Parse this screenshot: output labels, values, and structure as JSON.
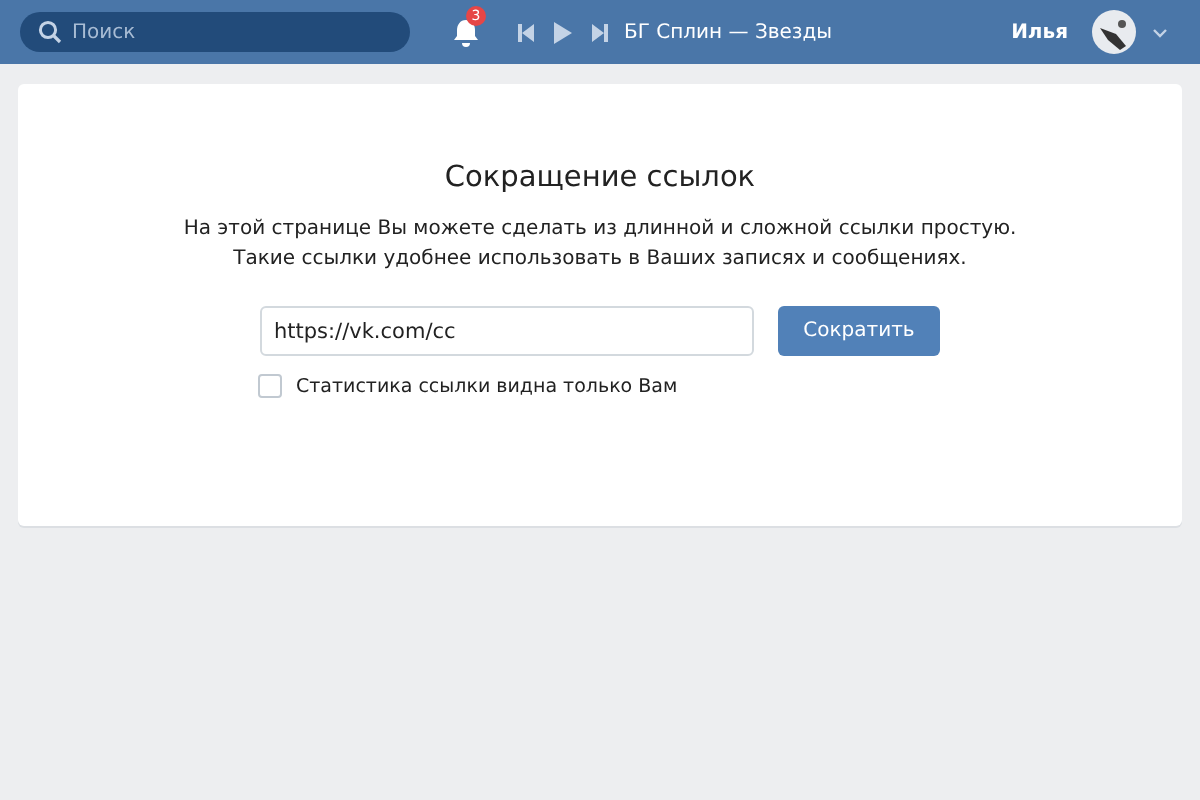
{
  "header": {
    "search": {
      "placeholder": "Поиск"
    },
    "notifications": {
      "count": "3"
    },
    "player": {
      "track": "БГ Сплин — Звезды"
    },
    "user": {
      "name": "Илья"
    }
  },
  "page": {
    "title": "Сокращение ссылок",
    "description": [
      "На этой странице Вы можете сделать из длинной и сложной ссылки простую.",
      "Такие ссылки удобнее использовать в Ваших записях и сообщениях."
    ],
    "link_field": {
      "value": "https://vk.com/cc"
    },
    "shorten_button": "Сократить",
    "private_stats": {
      "label": "Статистика ссылки видна только Вам",
      "checked": false
    }
  }
}
